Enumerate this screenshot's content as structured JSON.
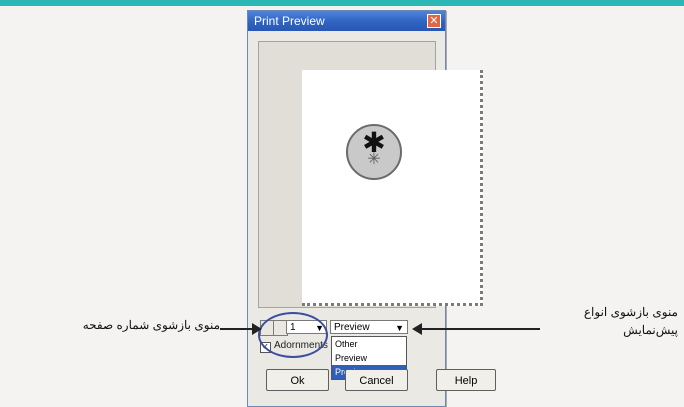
{
  "dialog": {
    "title": "Print Preview",
    "close_symbol": "✕"
  },
  "preview": {
    "emblem_big": "✱",
    "emblem_small": "✳"
  },
  "controls": {
    "page_value": "1",
    "mode_value": "Preview",
    "dropdown_options": [
      "Other",
      "Preview",
      "Preview"
    ],
    "checkbox_label": "Adornments",
    "ok_label": "Ok",
    "cancel_label": "Cancel",
    "help_label": "Help",
    "dropdown_arrow": "▼"
  },
  "annotations": {
    "left_text": "منوی بازشوی شماره صفحه",
    "right_text_line1": "منوی بازشوی انواع",
    "right_text_line2": "پیش‌نمایش"
  },
  "colors": {
    "title_bar": "#2f63c2",
    "oval": "#3b4fa0",
    "top_stripe": "#2bb7b3"
  }
}
